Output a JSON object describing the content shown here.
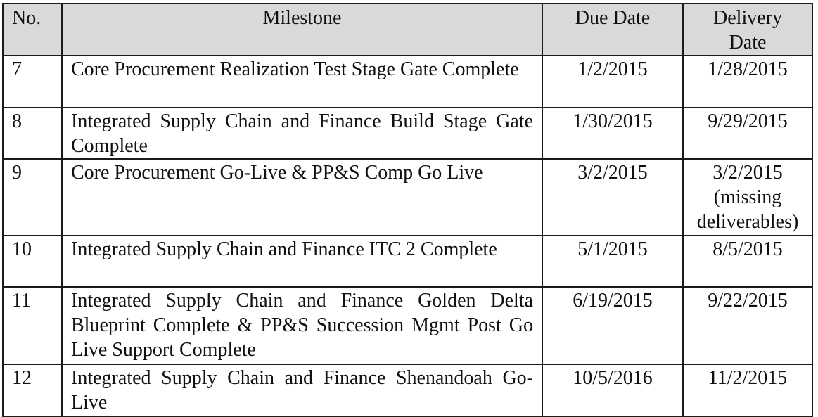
{
  "table": {
    "headers": {
      "no": "No.",
      "milestone": "Milestone",
      "due_date": "Due Date",
      "delivery_date_line1": "Delivery",
      "delivery_date_line2": "Date"
    },
    "rows": [
      {
        "no": "7",
        "milestone": "Core Procurement Realization Test Stage Gate Complete",
        "due_date": "1/2/2015",
        "delivery_date": "1/28/2015",
        "delivery_note_line1": "",
        "delivery_note_line2": ""
      },
      {
        "no": "8",
        "milestone": "Integrated Supply Chain and Finance Build Stage Gate Complete",
        "due_date": "1/30/2015",
        "delivery_date": "9/29/2015",
        "delivery_note_line1": "",
        "delivery_note_line2": ""
      },
      {
        "no": "9",
        "milestone": "Core Procurement Go-Live & PP&S Comp Go Live",
        "due_date": "3/2/2015",
        "delivery_date": "3/2/2015",
        "delivery_note_line1": "(missing",
        "delivery_note_line2": "deliverables)"
      },
      {
        "no": "10",
        "milestone": "Integrated Supply Chain and Finance ITC 2 Complete",
        "due_date": "5/1/2015",
        "delivery_date": "8/5/2015",
        "delivery_note_line1": "",
        "delivery_note_line2": ""
      },
      {
        "no": "11",
        "milestone": "Integrated Supply Chain and Finance Golden Delta Blueprint Complete & PP&S Succession Mgmt Post Go Live Support Complete",
        "due_date": "6/19/2015",
        "delivery_date": "9/22/2015",
        "delivery_note_line1": "",
        "delivery_note_line2": ""
      },
      {
        "no": "12",
        "milestone": "Integrated Supply Chain and Finance Shenandoah Go-Live",
        "due_date": "10/5/2016",
        "delivery_date": "11/2/2015",
        "delivery_note_line1": "",
        "delivery_note_line2": ""
      }
    ]
  },
  "colors": {
    "header_background": "#d9d9d9",
    "border": "#1a1a1a",
    "text": "#111111"
  }
}
